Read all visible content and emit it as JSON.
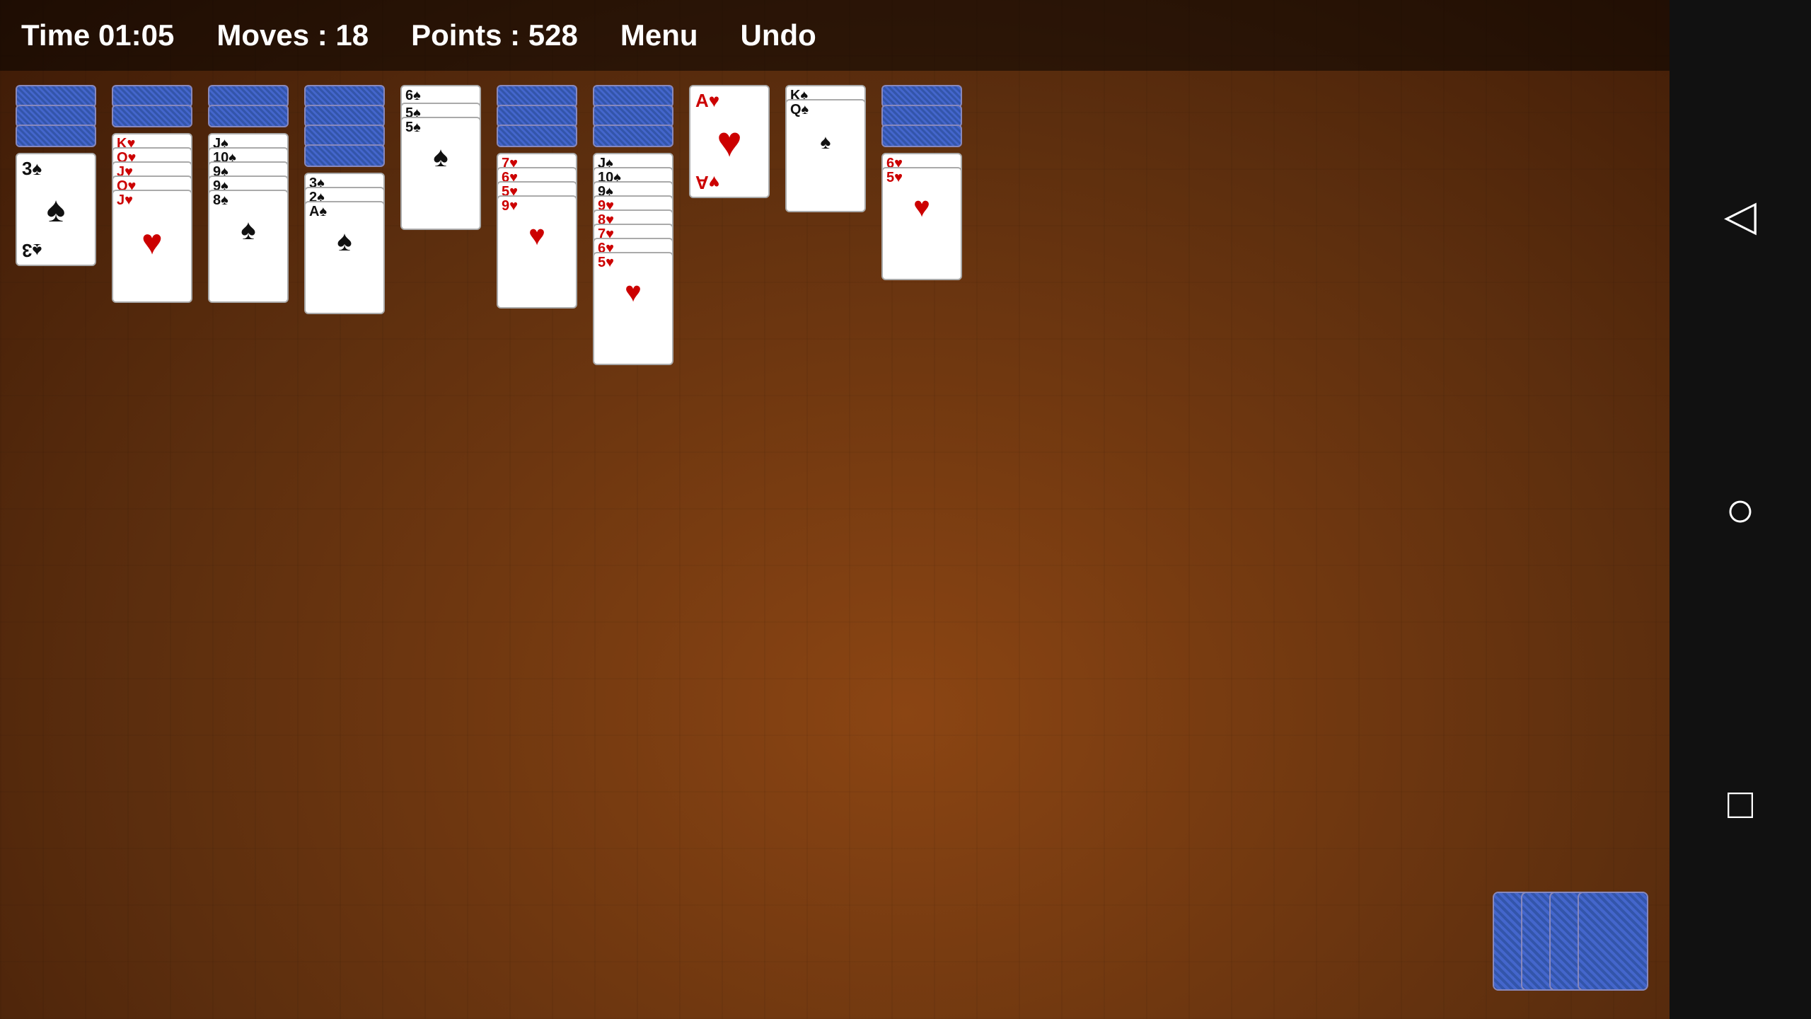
{
  "header": {
    "time_label": "Time 01:05",
    "moves_label": "Moves : 18",
    "points_label": "Points : 528",
    "menu_label": "Menu",
    "undo_label": "Undo"
  },
  "game": {
    "columns": [
      {
        "id": "col1",
        "face_down": 3,
        "face_up": [
          {
            "rank": "3",
            "suit": "♠",
            "color": "black"
          }
        ]
      },
      {
        "id": "col2",
        "face_down": 2,
        "face_up": [
          {
            "rank": "K",
            "suit": "♥",
            "color": "red"
          },
          {
            "rank": "Q",
            "suit": "♥",
            "color": "red"
          },
          {
            "rank": "J",
            "suit": "♥",
            "color": "red"
          },
          {
            "rank": "Q",
            "suit": "♥",
            "color": "red"
          },
          {
            "rank": "J",
            "suit": "♥",
            "color": "red"
          }
        ]
      },
      {
        "id": "col3",
        "face_down": 2,
        "face_up": [
          {
            "rank": "J",
            "suit": "♠",
            "color": "black"
          },
          {
            "rank": "10",
            "suit": "♠",
            "color": "black"
          },
          {
            "rank": "9",
            "suit": "♠",
            "color": "black"
          },
          {
            "rank": "9",
            "suit": "♠",
            "color": "black"
          },
          {
            "rank": "8",
            "suit": "♠",
            "color": "black"
          }
        ]
      },
      {
        "id": "col4",
        "face_down": 4,
        "face_up": [
          {
            "rank": "3",
            "suit": "♠",
            "color": "black"
          },
          {
            "rank": "2",
            "suit": "♠",
            "color": "black"
          },
          {
            "rank": "A",
            "suit": "♠",
            "color": "black"
          }
        ]
      },
      {
        "id": "col5",
        "face_down": 0,
        "face_up": [
          {
            "rank": "6",
            "suit": "♠",
            "color": "black"
          },
          {
            "rank": "5",
            "suit": "♠",
            "color": "black"
          },
          {
            "rank": "5",
            "suit": "♠",
            "color": "black"
          }
        ]
      },
      {
        "id": "col6",
        "face_down": 3,
        "face_up": [
          {
            "rank": "7",
            "suit": "♥",
            "color": "red"
          },
          {
            "rank": "6",
            "suit": "♥",
            "color": "red"
          },
          {
            "rank": "5",
            "suit": "♥",
            "color": "red"
          },
          {
            "rank": "9",
            "suit": "♥",
            "color": "red"
          }
        ]
      },
      {
        "id": "col7",
        "face_down": 3,
        "face_up": [
          {
            "rank": "J",
            "suit": "♠",
            "color": "black"
          },
          {
            "rank": "10",
            "suit": "♠",
            "color": "black"
          },
          {
            "rank": "9",
            "suit": "♠",
            "color": "black"
          },
          {
            "rank": "9",
            "suit": "♥",
            "color": "red"
          },
          {
            "rank": "8",
            "suit": "♥",
            "color": "red"
          },
          {
            "rank": "7",
            "suit": "♥",
            "color": "red"
          },
          {
            "rank": "6",
            "suit": "♥",
            "color": "red"
          },
          {
            "rank": "5",
            "suit": "♥",
            "color": "red"
          }
        ]
      },
      {
        "id": "col8",
        "face_down": 0,
        "face_up": [
          {
            "rank": "A",
            "suit": "♥",
            "color": "red"
          }
        ]
      },
      {
        "id": "col9",
        "face_down": 0,
        "face_up": [
          {
            "rank": "K",
            "suit": "♠",
            "color": "black"
          },
          {
            "rank": "Q",
            "suit": "♠",
            "color": "black"
          }
        ]
      },
      {
        "id": "col10",
        "face_down": 3,
        "face_up": [
          {
            "rank": "6",
            "suit": "♥",
            "color": "red"
          },
          {
            "rank": "5",
            "suit": "♥",
            "color": "red"
          }
        ]
      }
    ]
  },
  "nav": {
    "back": "◁",
    "circle": "○",
    "square": "□"
  }
}
